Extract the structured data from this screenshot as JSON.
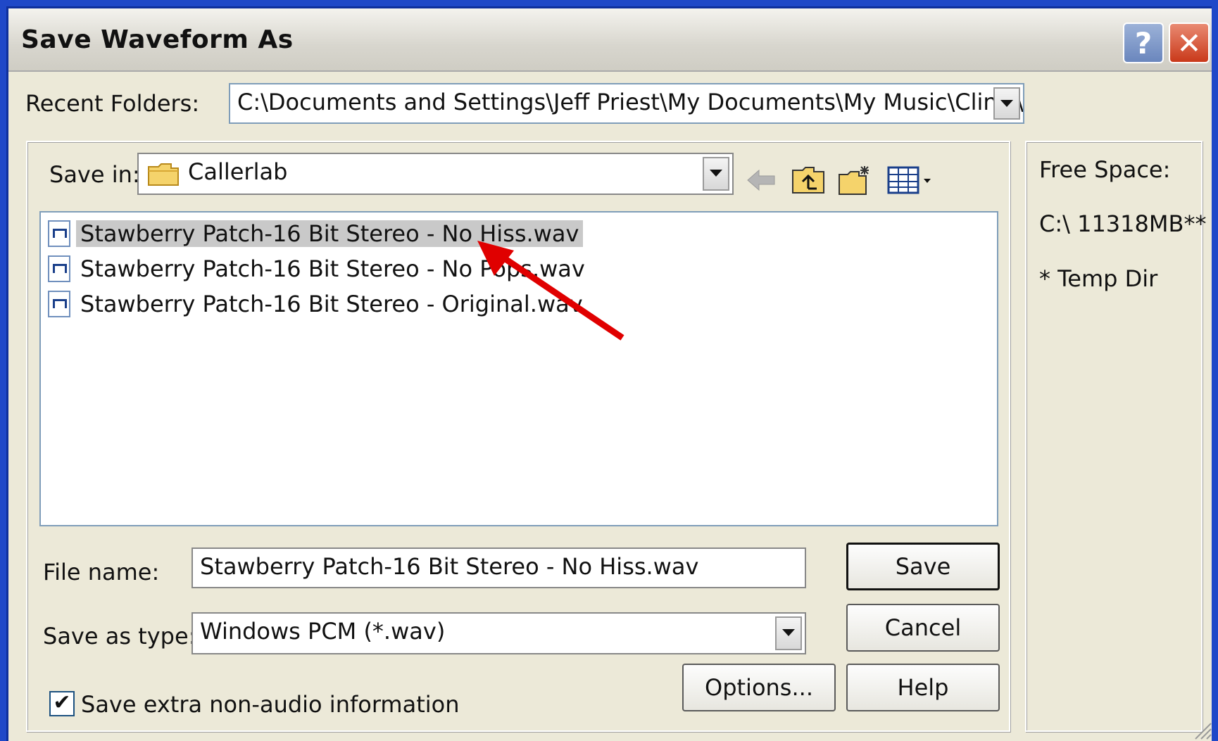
{
  "window": {
    "title": "Save Waveform As"
  },
  "recent_folders": {
    "label": "Recent Folders:",
    "value": "C:\\Documents and Settings\\Jeff Priest\\My Documents\\My Music\\Clinic\\Calle"
  },
  "save_in": {
    "label": "Save in:",
    "value": "Callerlab"
  },
  "files": [
    {
      "name": "Stawberry Patch-16 Bit Stereo - No Hiss.wav",
      "selected": true
    },
    {
      "name": "Stawberry Patch-16 Bit Stereo - No Pops.wav",
      "selected": false
    },
    {
      "name": "Stawberry Patch-16 Bit Stereo - Original.wav",
      "selected": false
    }
  ],
  "file_name": {
    "label": "File name:",
    "value": "Stawberry Patch-16 Bit Stereo - No Hiss.wav"
  },
  "save_as_type": {
    "label": "Save as type:",
    "value": "Windows PCM (*.wav)"
  },
  "checkbox": {
    "label": "Save extra non-audio information",
    "checked_glyph": "✔"
  },
  "buttons": {
    "save": "Save",
    "cancel": "Cancel",
    "options": "Options...",
    "help": "Help",
    "title_help": "?",
    "title_close": "✕"
  },
  "free_space": {
    "label": "Free Space:",
    "drive": "C:\\  11318MB**",
    "note": "* Temp Dir"
  },
  "colors": {
    "accent": "#e00000",
    "selection": "#c9c9c9",
    "title_close": "#c9391a"
  }
}
